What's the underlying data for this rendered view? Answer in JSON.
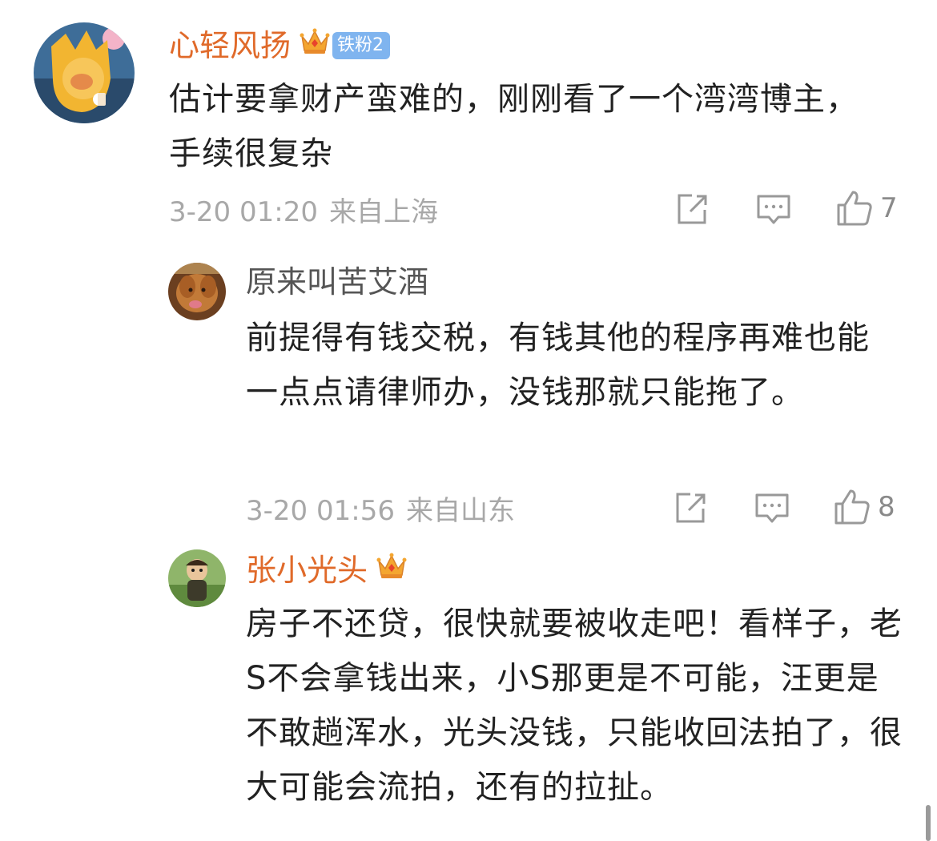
{
  "colors": {
    "username": "#e06a2a",
    "username_plain": "#555555",
    "fan_badge_bg": "#7fb4ef",
    "meta": "#a8a8a8",
    "icon": "#999999"
  },
  "comments": [
    {
      "username": "心轻风扬",
      "crown_icon": "crown-icon",
      "fan_badge": "铁粉2",
      "text": "估计要拿财产蛮难的，刚刚看了一个湾湾博主，手续很复杂",
      "date": "3-20 01:20",
      "location": "来自上海",
      "likes": "7"
    },
    {
      "username": "原来叫苦艾酒",
      "text": "前提得有钱交税，有钱其他的程序再难也能一点点请律师办，没钱那就只能拖了。",
      "date": "3-20 01:56",
      "location": "来自山东",
      "likes": "8"
    },
    {
      "username": "张小光头",
      "crown_icon": "crown-icon",
      "text": "房子不还贷，很快就要被收走吧！看样子，老S不会拿钱出来，小S那更是不可能，汪更是不敢趟浑水，光头没钱，只能收回法拍了，很大可能会流拍，还有的拉扯。"
    }
  ]
}
